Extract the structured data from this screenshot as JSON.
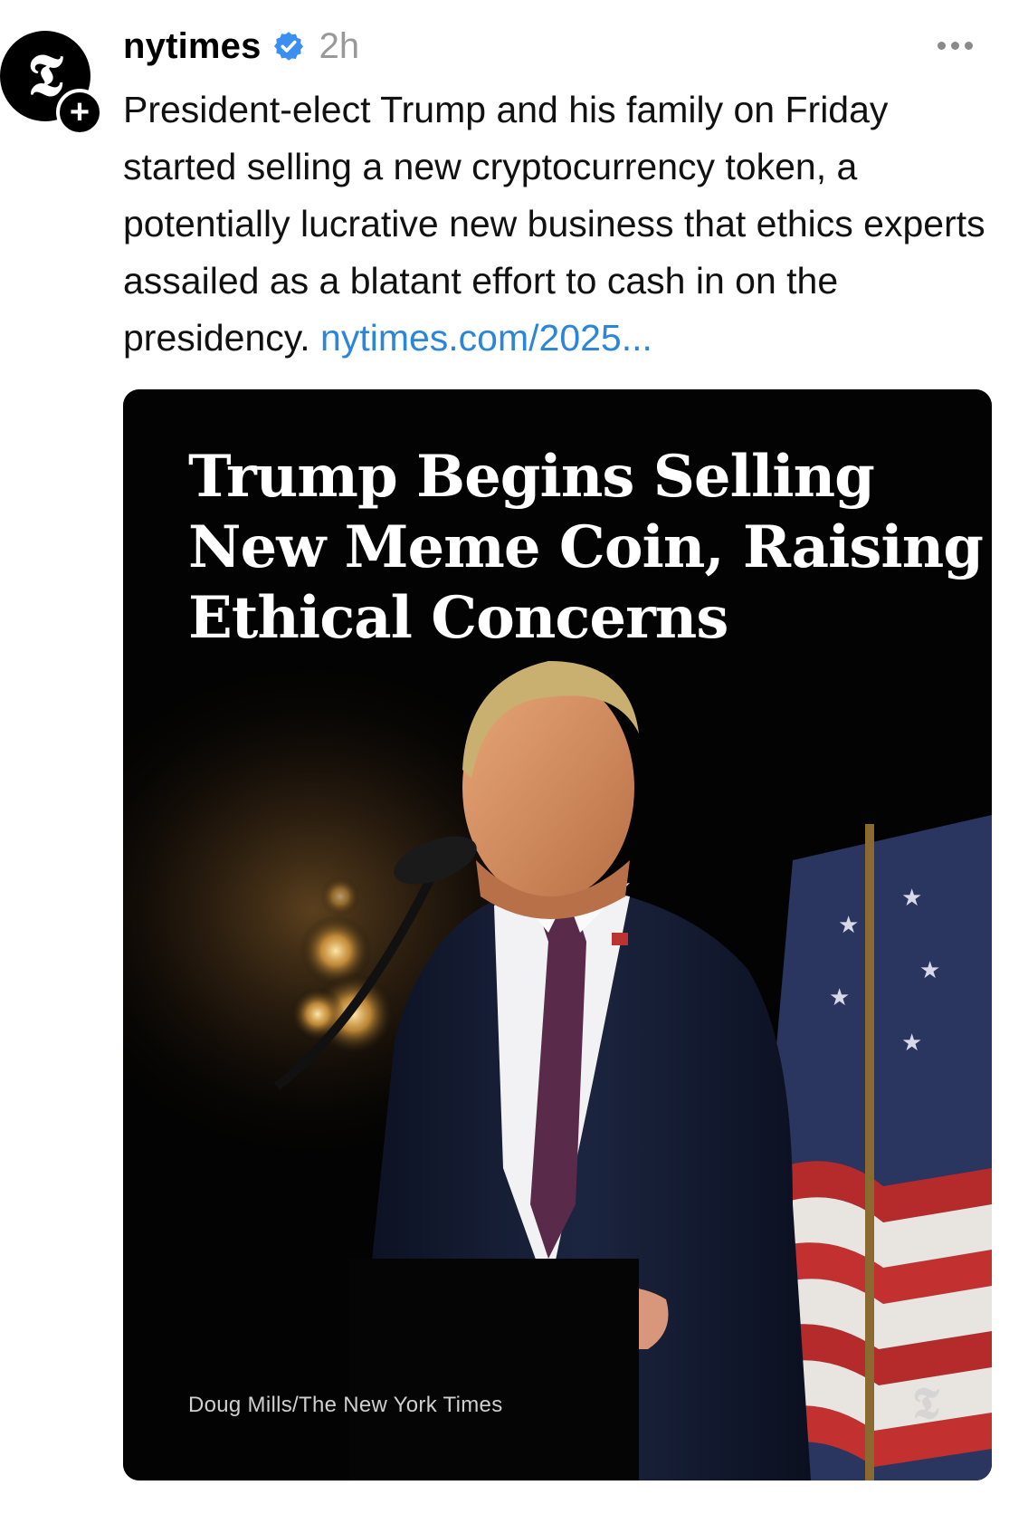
{
  "post": {
    "username": "nytimes",
    "timestamp": "2h",
    "avatar_glyph": "𝕿",
    "follow_icon": "plus-icon",
    "verified_icon": "verified-badge-icon",
    "more_icon": "more-options-icon",
    "text": "President-elect Trump and his family on Friday started selling a new cryptocurrency token, a potentially lucrative new business that ethics experts assailed as a blatant effort to cash in on the presidency. ",
    "link_text": "nytimes.com/2025...",
    "colors": {
      "link": "#2a86d9",
      "verified": "#3b8ff0",
      "timestamp": "#999999"
    }
  },
  "media": {
    "headline_lines": [
      "Trump Begins Selling",
      "New Meme Coin, Raising",
      "Ethical Concerns"
    ],
    "photo_credit": "Doug Mills/The New York Times",
    "watermark_glyph": "𝕿"
  }
}
